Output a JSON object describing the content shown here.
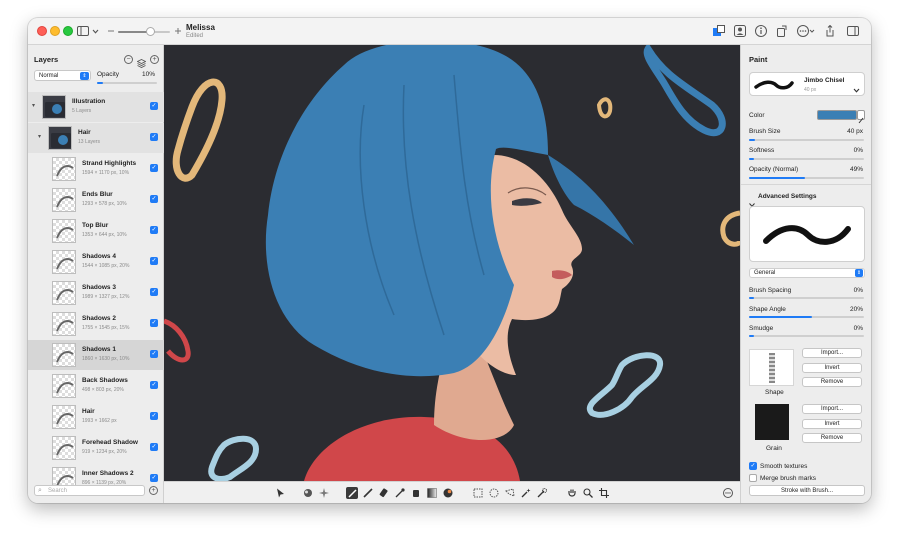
{
  "window": {
    "title": "Melissa",
    "subtitle": "Edited",
    "zoom_fraction": 0.62
  },
  "layers_panel": {
    "title": "Layers",
    "blend_mode": "Normal",
    "opacity_label": "Opacity",
    "opacity_value": "10%",
    "search_placeholder": "Search",
    "items": [
      {
        "name": "Illustration",
        "meta": "5 Layers",
        "level": 0,
        "type": "group"
      },
      {
        "name": "Hair",
        "meta": "13 Layers",
        "level": 1,
        "type": "group"
      },
      {
        "name": "Strand Highlights",
        "meta": "1594 × 1170 px, 10%",
        "level": 2,
        "type": "layer"
      },
      {
        "name": "Ends Blur",
        "meta": "1293 × 578 px, 10%",
        "level": 2,
        "type": "layer"
      },
      {
        "name": "Top Blur",
        "meta": "1353 × 644 px, 10%",
        "level": 2,
        "type": "layer"
      },
      {
        "name": "Shadows 4",
        "meta": "1544 × 1085 px, 20%",
        "level": 2,
        "type": "layer"
      },
      {
        "name": "Shadows 3",
        "meta": "1989 × 1327 px, 12%",
        "level": 2,
        "type": "layer"
      },
      {
        "name": "Shadows 2",
        "meta": "1755 × 1545 px, 15%",
        "level": 2,
        "type": "layer"
      },
      {
        "name": "Shadows 1",
        "meta": "1860 × 1630 px, 10%",
        "level": 2,
        "type": "layer",
        "selected": true
      },
      {
        "name": "Back Shadows",
        "meta": "498 × 803 px, 20%",
        "level": 2,
        "type": "layer"
      },
      {
        "name": "Hair",
        "meta": "1993 × 1662 px",
        "level": 2,
        "type": "layer"
      },
      {
        "name": "Forehead Shadow",
        "meta": "919 × 1234 px, 20%",
        "level": 2,
        "type": "layer"
      },
      {
        "name": "Inner Shadows 2",
        "meta": "896 × 1139 px, 20%",
        "level": 2,
        "type": "layer"
      }
    ]
  },
  "paint_panel": {
    "title": "Paint",
    "brush_name": "Jimbo Chisel",
    "brush_size_text": "40 px",
    "color_label": "Color",
    "color_value": "#3b7fb4",
    "brush_size_label": "Brush Size",
    "brush_size_value": "40 px",
    "brush_size_fraction": 0.05,
    "softness_label": "Softness",
    "softness_value": "0%",
    "softness_fraction": 0.0,
    "opacity_label": "Opacity (Normal)",
    "opacity_value": "49%",
    "opacity_fraction": 0.49,
    "advanced_label": "Advanced Settings",
    "category": "General",
    "spacing_label": "Brush Spacing",
    "spacing_value": "0%",
    "spacing_fraction": 0.0,
    "angle_label": "Shape Angle",
    "angle_value": "20%",
    "angle_fraction": 0.55,
    "smudge_label": "Smudge",
    "smudge_value": "0%",
    "smudge_fraction": 0.0,
    "import_label": "Import...",
    "invert_label": "Invert",
    "remove_label": "Remove",
    "shape_label": "Shape",
    "grain_label": "Grain",
    "smooth_label": "Smooth textures",
    "merge_label": "Merge brush marks",
    "stroke_button": "Stroke with Brush..."
  },
  "toolbar_icons": [
    "pointer-icon",
    "smudge-icon",
    "sparkle-icon",
    "brush-icon",
    "pencil-icon",
    "eraser-icon",
    "eyedropper-icon",
    "bucket-icon",
    "gradient-icon",
    "color-fill-icon",
    "rect-select-icon",
    "ellipse-select-icon",
    "lasso-icon",
    "magic-wand-icon",
    "selection-brush-icon",
    "hand-icon",
    "zoom-icon",
    "crop-icon",
    "more-icon"
  ],
  "colors": {
    "canvas_bg": "#2b2c31",
    "hair": "#3b7fb4",
    "shirt": "#d0474a",
    "skin": "#e8b8a0",
    "accent": "#1f7bf6"
  }
}
